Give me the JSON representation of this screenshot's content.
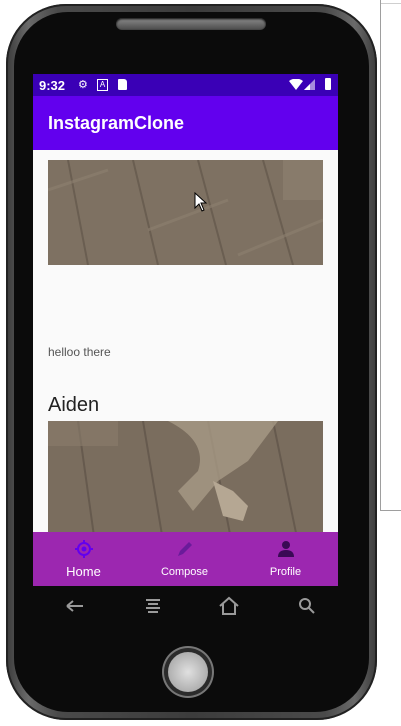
{
  "status_bar": {
    "time": "9:32",
    "icons": [
      "settings-icon",
      "a-icon",
      "sd-card-icon",
      "wifi-icon",
      "signal-icon",
      "battery-icon"
    ]
  },
  "app_bar": {
    "title": "InstagramClone"
  },
  "feed": {
    "posts": [
      {
        "username": "",
        "caption": "helloo there",
        "image": "wooden-floor-photo"
      },
      {
        "username": "Aiden",
        "caption": "",
        "image": "wooden-floor-cat-photo"
      }
    ]
  },
  "bottom_nav": {
    "items": [
      {
        "label": "Home",
        "icon": "home-icon",
        "active": true
      },
      {
        "label": "Compose",
        "icon": "pencil-icon",
        "active": false
      },
      {
        "label": "Profile",
        "icon": "person-icon",
        "active": false
      }
    ]
  },
  "system_nav": [
    "back-icon",
    "menu-icon",
    "home-icon",
    "search-icon"
  ],
  "colors": {
    "status_bar": "#3a00b6",
    "app_bar": "#6200ee",
    "bottom_nav": "#9c27b0",
    "active_icon": "#6200ee"
  }
}
